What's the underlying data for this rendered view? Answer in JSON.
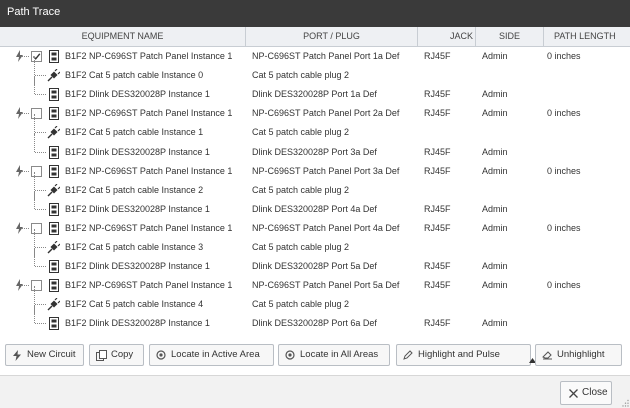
{
  "window": {
    "title": "Path Trace"
  },
  "columns": {
    "equipment": "EQUIPMENT NAME",
    "port": "PORT / PLUG",
    "jack": "JACK",
    "side": "SIDE",
    "path": "PATH LENGTH"
  },
  "rows": [
    {
      "equipment": "B1F2 NP-C696ST Patch Panel Instance 1",
      "port": "NP-C696ST Patch Panel Port 1a Def",
      "jack": "RJ45F",
      "side": "Admin",
      "path": "0 inches",
      "checked": true
    },
    {
      "equipment": "B1F2 Cat 5 patch cable Instance 0",
      "port": "Cat 5 patch cable plug 2",
      "jack": "",
      "side": "",
      "path": ""
    },
    {
      "equipment": "B1F2 Dlink DES320028P Instance 1",
      "port": "Dlink DES320028P Port 1a Def",
      "jack": "RJ45F",
      "side": "Admin",
      "path": ""
    },
    {
      "equipment": "B1F2 NP-C696ST Patch Panel Instance 1",
      "port": "NP-C696ST Patch Panel Port 2a Def",
      "jack": "RJ45F",
      "side": "Admin",
      "path": "0 inches",
      "checked": false
    },
    {
      "equipment": "B1F2 Cat 5 patch cable Instance 1",
      "port": "Cat 5 patch cable plug 2",
      "jack": "",
      "side": "",
      "path": ""
    },
    {
      "equipment": "B1F2 Dlink DES320028P Instance 1",
      "port": "Dlink DES320028P Port 3a Def",
      "jack": "RJ45F",
      "side": "Admin",
      "path": ""
    },
    {
      "equipment": "B1F2 NP-C696ST Patch Panel Instance 1",
      "port": "NP-C696ST Patch Panel Port 3a Def",
      "jack": "RJ45F",
      "side": "Admin",
      "path": "0 inches",
      "checked": false
    },
    {
      "equipment": "B1F2 Cat 5 patch cable Instance 2",
      "port": "Cat 5 patch cable plug 2",
      "jack": "",
      "side": "",
      "path": ""
    },
    {
      "equipment": "B1F2 Dlink DES320028P Instance 1",
      "port": "Dlink DES320028P Port 4a Def",
      "jack": "RJ45F",
      "side": "Admin",
      "path": ""
    },
    {
      "equipment": "B1F2 NP-C696ST Patch Panel Instance 1",
      "port": "NP-C696ST Patch Panel Port 4a Def",
      "jack": "RJ45F",
      "side": "Admin",
      "path": "0 inches",
      "checked": false
    },
    {
      "equipment": "B1F2 Cat 5 patch cable Instance 3",
      "port": "Cat 5 patch cable plug 2",
      "jack": "",
      "side": "",
      "path": ""
    },
    {
      "equipment": "B1F2 Dlink DES320028P Instance 1",
      "port": "Dlink DES320028P Port 5a Def",
      "jack": "RJ45F",
      "side": "Admin",
      "path": ""
    },
    {
      "equipment": "B1F2 NP-C696ST Patch Panel Instance 1",
      "port": "NP-C696ST Patch Panel Port 5a Def",
      "jack": "RJ45F",
      "side": "Admin",
      "path": "0 inches",
      "checked": false
    },
    {
      "equipment": "B1F2 Cat 5 patch cable Instance 4",
      "port": "Cat 5 patch cable plug 2",
      "jack": "",
      "side": "",
      "path": ""
    },
    {
      "equipment": "B1F2 Dlink DES320028P Instance 1",
      "port": "Dlink DES320028P Port 6a Def",
      "jack": "RJ45F",
      "side": "Admin",
      "path": ""
    }
  ],
  "toolbar": {
    "new_circuit": "New Circuit",
    "copy": "Copy",
    "locate_active": "Locate in Active Area",
    "locate_all": "Locate in All Areas",
    "highlight": "Highlight and Pulse",
    "unhighlight": "Unhighlight"
  },
  "footer": {
    "close": "Close"
  }
}
